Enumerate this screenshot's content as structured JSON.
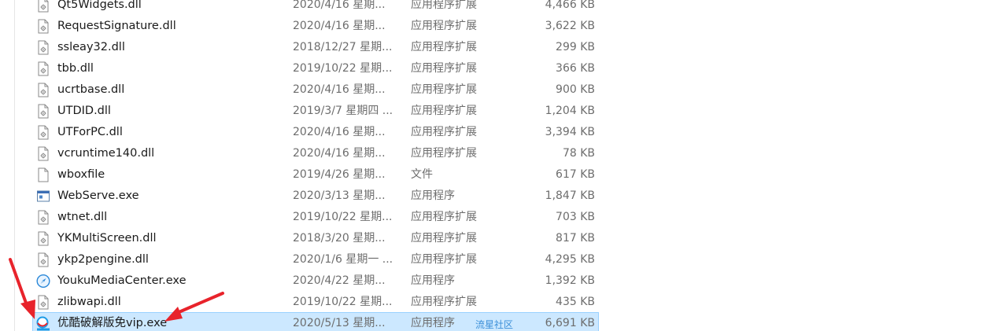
{
  "files": [
    {
      "name": "Qt5Widgets.dll",
      "date": "2020/4/16 星期...",
      "type": "应用程序扩展",
      "size": "4,466 KB",
      "icon": "dll-file-icon"
    },
    {
      "name": "RequestSignature.dll",
      "date": "2020/4/16 星期...",
      "type": "应用程序扩展",
      "size": "3,622 KB",
      "icon": "dll-file-icon"
    },
    {
      "name": "ssleay32.dll",
      "date": "2018/12/27 星期...",
      "type": "应用程序扩展",
      "size": "299 KB",
      "icon": "dll-file-icon"
    },
    {
      "name": "tbb.dll",
      "date": "2019/10/22 星期...",
      "type": "应用程序扩展",
      "size": "366 KB",
      "icon": "dll-file-icon"
    },
    {
      "name": "ucrtbase.dll",
      "date": "2020/4/16 星期...",
      "type": "应用程序扩展",
      "size": "900 KB",
      "icon": "dll-file-icon"
    },
    {
      "name": "UTDID.dll",
      "date": "2019/3/7 星期四 ...",
      "type": "应用程序扩展",
      "size": "1,204 KB",
      "icon": "dll-file-icon"
    },
    {
      "name": "UTForPC.dll",
      "date": "2020/4/16 星期...",
      "type": "应用程序扩展",
      "size": "3,394 KB",
      "icon": "dll-file-icon"
    },
    {
      "name": "vcruntime140.dll",
      "date": "2020/4/16 星期...",
      "type": "应用程序扩展",
      "size": "78 KB",
      "icon": "dll-file-icon"
    },
    {
      "name": "wboxfile",
      "date": "2019/4/26 星期...",
      "type": "文件",
      "size": "617 KB",
      "icon": "blank-file-icon"
    },
    {
      "name": "WebServe.exe",
      "date": "2020/3/13 星期...",
      "type": "应用程序",
      "size": "1,847 KB",
      "icon": "exe-window-icon"
    },
    {
      "name": "wtnet.dll",
      "date": "2019/10/22 星期...",
      "type": "应用程序扩展",
      "size": "703 KB",
      "icon": "dll-file-icon"
    },
    {
      "name": "YKMultiScreen.dll",
      "date": "2018/3/20 星期...",
      "type": "应用程序扩展",
      "size": "817 KB",
      "icon": "dll-file-icon"
    },
    {
      "name": "ykp2pengine.dll",
      "date": "2020/1/6 星期一 ...",
      "type": "应用程序扩展",
      "size": "4,295 KB",
      "icon": "dll-file-icon"
    },
    {
      "name": "YoukuMediaCenter.exe",
      "date": "2020/4/22 星期...",
      "type": "应用程序",
      "size": "1,392 KB",
      "icon": "compass-icon"
    },
    {
      "name": "zlibwapi.dll",
      "date": "2019/10/22 星期...",
      "type": "应用程序扩展",
      "size": "435 KB",
      "icon": "dll-file-icon"
    },
    {
      "name": "优酷破解版免vip.exe",
      "date": "2020/5/13 星期...",
      "type": "应用程序",
      "size": "6,691 KB",
      "icon": "youku-app-icon",
      "selected": true
    }
  ],
  "watermark": "流星社区",
  "colors": {
    "selection": "#cce8ff",
    "selection_border": "#99d1ff",
    "meta_text": "#6d6d6d",
    "annotation_arrow": "#e8232b"
  }
}
